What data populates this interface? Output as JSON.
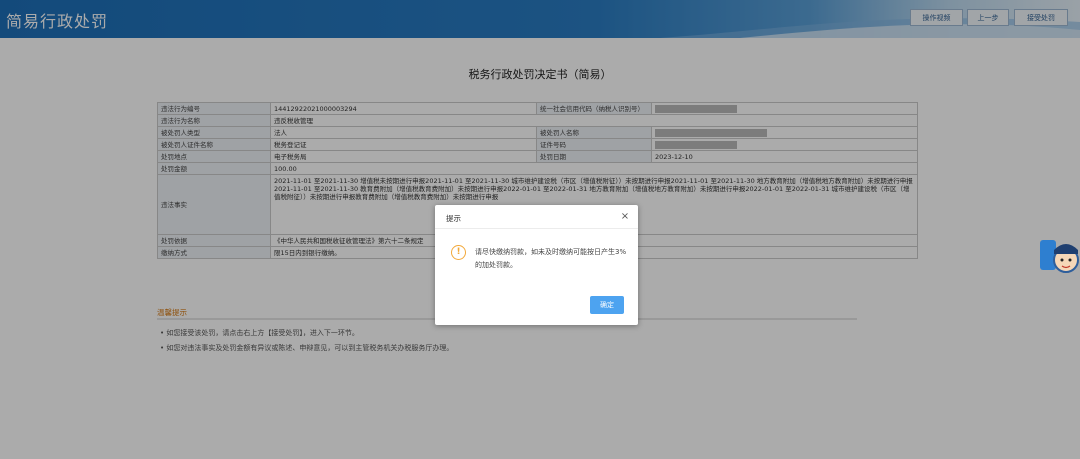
{
  "header": {
    "title": "简易行政处罚",
    "buttons": {
      "guide": "操作视频",
      "prev": "上一步",
      "accept": "接受处罚"
    }
  },
  "document": {
    "title": "税务行政处罚决定书（简易）",
    "rows": {
      "violation_no_label": "违法行为编号",
      "violation_no": "14412922021000003294",
      "credit_code_label": "统一社会信用代码（纳税人识别号）",
      "violation_name_label": "违法行为名称",
      "violation_name": "违反税收管理",
      "party_type_label": "被处罚人类型",
      "party_type": "法人",
      "party_name_label": "被处罚人名称",
      "cert_name_label": "被处罚人证件名称",
      "cert_name": "税务登记证",
      "cert_no_label": "证件号码",
      "place_label": "处罚地点",
      "place": "电子税务局",
      "date_label": "处罚日期",
      "date": "2023-12-10",
      "amount_label": "处罚金额",
      "amount": "100.00",
      "facts_label": "违法事实",
      "facts": "2021-11-01 至2021-11-30 增值税未按期进行申报2021-11-01 至2021-11-30 城市维护建设税（市区（增值税附征））未按期进行申报2021-11-01 至2021-11-30 地方教育附加（增值税地方教育附加）未按期进行申报2021-11-01 至2021-11-30 教育费附加（增值税教育费附加）未按期进行申报2022-01-01 至2022-01-31 地方教育附加（增值税地方教育附加）未按期进行申报2022-01-01 至2022-01-31 城市维护建设税（市区（增值税附征））未按期进行申报教育费附加（增值税教育费附加）未按期进行申报",
      "basis_label": "处罚依据",
      "basis": "《中华人民共和国税收征收管理法》第六十二条规定",
      "payment_label": "缴纳方式",
      "payment": "限15日内到银行缴纳。"
    }
  },
  "tips": {
    "title": "温馨提示",
    "items": [
      "如您接受该处罚，请点击右上方【接受处罚】，进入下一环节。",
      "如您对违法事实及处罚金额有异议或陈述、申辩意见，可以到主管税务机关办税服务厅办理。"
    ]
  },
  "dialog": {
    "title": "提示",
    "close": "×",
    "icon": "!",
    "message": "请尽快缴纳罚款，如未及时缴纳可能按日产生3%的加处罚款。",
    "ok": "确定"
  },
  "assistant": {
    "label": "纳税咨询"
  },
  "colors": {
    "header_blue": "#1d6fb8",
    "accent_orange": "#d57a14",
    "ok_blue": "#4da3f0",
    "warn": "#f2a93b"
  }
}
